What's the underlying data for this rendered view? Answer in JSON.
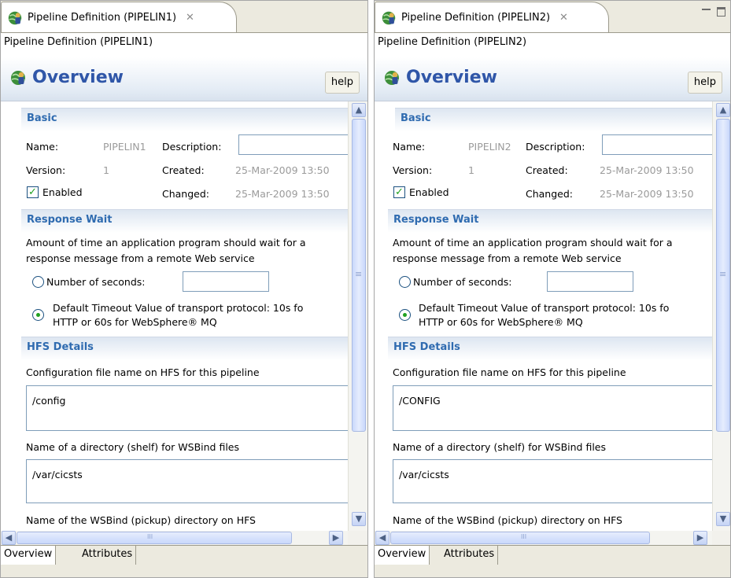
{
  "editors": [
    {
      "tab_title": "Pipeline Definition (PIPELIN1)",
      "path_title": "Pipeline Definition (PIPELIN1)",
      "overview_title": "Overview",
      "help_label": "help",
      "basic": {
        "title": "Basic",
        "name_label": "Name:",
        "name_value": "PIPELIN1",
        "description_label": "Description:",
        "description_value": "",
        "version_label": "Version:",
        "version_value": "1",
        "created_label": "Created:",
        "created_value": "25-Mar-2009 13:50",
        "enabled_label": "Enabled",
        "enabled_checked": true,
        "changed_label": "Changed:",
        "changed_value": "25-Mar-2009 13:50"
      },
      "response_wait": {
        "title": "Response Wait",
        "desc_line1": "Amount of time an application program should wait for a",
        "desc_line2": "response message from a remote Web service",
        "seconds_label": "Number of seconds:",
        "seconds_value": "",
        "default_line1": "Default Timeout Value of transport protocol: 10s fo",
        "default_line2": "HTTP or 60s for WebSphere® MQ",
        "selected_option": "default"
      },
      "hfs": {
        "title": "HFS Details",
        "config_label": "Configuration file name on HFS for this pipeline",
        "config_value": "/config",
        "shelf_label": "Name of a directory (shelf) for WSBind files",
        "shelf_value": "/var/cicsts",
        "pickup_label": "Name of the WSBind (pickup) directory on HFS"
      },
      "bottom_tabs": [
        "Overview",
        "Attributes"
      ]
    },
    {
      "tab_title": "Pipeline Definition (PIPELIN2)",
      "path_title": "Pipeline Definition (PIPELIN2)",
      "overview_title": "Overview",
      "help_label": "help",
      "basic": {
        "title": "Basic",
        "name_label": "Name:",
        "name_value": "PIPELIN2",
        "description_label": "Description:",
        "description_value": "",
        "version_label": "Version:",
        "version_value": "1",
        "created_label": "Created:",
        "created_value": "25-Mar-2009 13:50",
        "enabled_label": "Enabled",
        "enabled_checked": true,
        "changed_label": "Changed:",
        "changed_value": "25-Mar-2009 13:50"
      },
      "response_wait": {
        "title": "Response Wait",
        "desc_line1": "Amount of time an application program should wait for a",
        "desc_line2": "response message from a remote Web service",
        "seconds_label": "Number of seconds:",
        "seconds_value": "",
        "default_line1": "Default Timeout Value of transport protocol: 10s fo",
        "default_line2": "HTTP or 60s for WebSphere® MQ",
        "selected_option": "default"
      },
      "hfs": {
        "title": "HFS Details",
        "config_label": "Configuration file name on HFS for this pipeline",
        "config_value": "/CONFIG",
        "shelf_label": "Name of a directory (shelf) for WSBind files",
        "shelf_value": "/var/cicsts",
        "pickup_label": "Name of the WSBind (pickup) directory on HFS"
      },
      "bottom_tabs": [
        "Overview",
        "Attributes"
      ]
    }
  ],
  "colors": {
    "section_title": "#2f6bb0",
    "overview_title": "#2f56a8",
    "value_grey": "#9b9b9b",
    "check_green": "#21a121"
  }
}
